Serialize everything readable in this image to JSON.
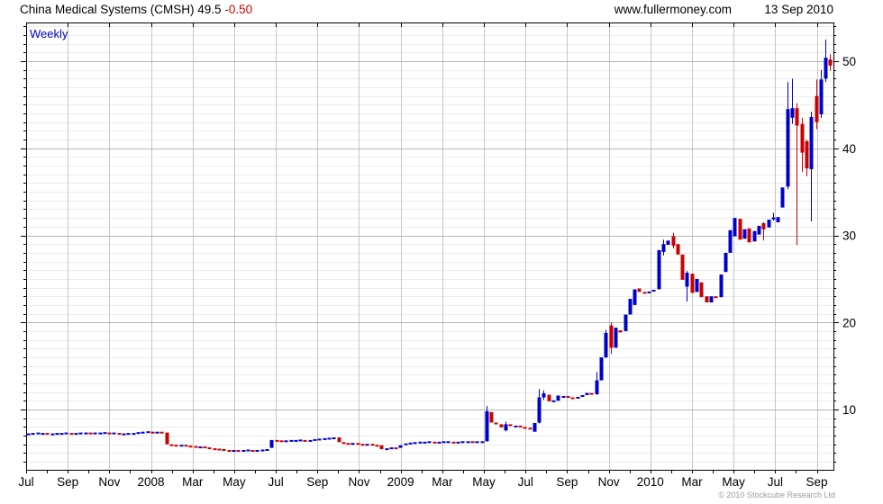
{
  "header": {
    "title": "China Medical Systems (CMSH) 49.5",
    "change": "-0.50",
    "site": "www.fullermoney.com",
    "date": "13 Sep 2010"
  },
  "footer": {
    "copyright": "© 2010 Stockcube Research Ltd"
  },
  "chart_data": {
    "type": "candlestick",
    "period_label": "Weekly",
    "title": "China Medical Systems (CMSH) weekly price",
    "colors": {
      "up": "#0000cc",
      "down": "#cc0000",
      "grid_minor": "#ececec",
      "grid_major": "#b5b5b5",
      "grid_vertical": "#c6c6c6",
      "frame": "#000000",
      "period_label": "#0000cc",
      "change_negative": "#cc0000",
      "copyright": "#9a9a9a"
    },
    "y_axis": {
      "ticks": [
        50,
        40,
        30,
        20,
        10
      ],
      "minor_step": 1,
      "minor_min": 4,
      "minor_max": 54,
      "range_top": 54.4,
      "range_bottom": 3.0,
      "scale": "linear",
      "side": "right"
    },
    "x_axis": {
      "months_visible": 38.8,
      "labels": [
        {
          "m": 0,
          "t": "Jul"
        },
        {
          "m": 2,
          "t": "Sep"
        },
        {
          "m": 4,
          "t": "Nov"
        },
        {
          "m": 6,
          "t": "2008"
        },
        {
          "m": 8,
          "t": "Mar"
        },
        {
          "m": 10,
          "t": "May"
        },
        {
          "m": 12,
          "t": "Jul"
        },
        {
          "m": 14,
          "t": "Sep"
        },
        {
          "m": 16,
          "t": "Nov"
        },
        {
          "m": 18,
          "t": "2009"
        },
        {
          "m": 20,
          "t": "Mar"
        },
        {
          "m": 22,
          "t": "May"
        },
        {
          "m": 24,
          "t": "Jul"
        },
        {
          "m": 26,
          "t": "Sep"
        },
        {
          "m": 28,
          "t": "Nov"
        },
        {
          "m": 30,
          "t": "2010"
        },
        {
          "m": 32,
          "t": "Mar"
        },
        {
          "m": 34,
          "t": "May"
        },
        {
          "m": 36,
          "t": "Jul"
        },
        {
          "m": 38,
          "t": "Sep"
        }
      ]
    },
    "weeks": [
      [
        7.2,
        7.25
      ],
      [
        7.25,
        7.3
      ],
      [
        7.3,
        7.35
      ],
      [
        7.25,
        7.3
      ],
      [
        7.3,
        7.2
      ],
      [
        7.2,
        7.25
      ],
      [
        7.25,
        7.3
      ],
      [
        7.25,
        7.3
      ],
      [
        7.3,
        7.35
      ],
      [
        7.3,
        7.25
      ],
      [
        7.25,
        7.3
      ],
      [
        7.3,
        7.35
      ],
      [
        7.3,
        7.35
      ],
      [
        7.35,
        7.3
      ],
      [
        7.3,
        7.35
      ],
      [
        7.3,
        7.35
      ],
      [
        7.35,
        7.4
      ],
      [
        7.35,
        7.3
      ],
      [
        7.3,
        7.35
      ],
      [
        7.3,
        7.2
      ],
      [
        7.2,
        7.25
      ],
      [
        7.25,
        7.3
      ],
      [
        7.25,
        7.3
      ],
      [
        7.3,
        7.4
      ],
      [
        7.4,
        7.45
      ],
      [
        7.4,
        7.5
      ],
      [
        7.45,
        7.4
      ],
      [
        7.4,
        7.45
      ],
      [
        7.45,
        7.35
      ],
      [
        7.35,
        6.0
      ],
      [
        6.0,
        5.95
      ],
      [
        5.95,
        5.9
      ],
      [
        5.9,
        5.95
      ],
      [
        5.95,
        5.85
      ],
      [
        5.85,
        5.8
      ],
      [
        5.8,
        5.7
      ],
      [
        5.7,
        5.75
      ],
      [
        5.75,
        5.65
      ],
      [
        5.65,
        5.55
      ],
      [
        5.55,
        5.5
      ],
      [
        5.5,
        5.45
      ],
      [
        5.45,
        5.35
      ],
      [
        5.35,
        5.3
      ],
      [
        5.3,
        5.35
      ],
      [
        5.35,
        5.3
      ],
      [
        5.3,
        5.35
      ],
      [
        5.35,
        5.4
      ],
      [
        5.35,
        5.3
      ],
      [
        5.3,
        5.35
      ],
      [
        5.35,
        5.4
      ],
      [
        5.4,
        5.45
      ],
      [
        5.6,
        6.5
      ],
      [
        6.5,
        6.45
      ],
      [
        6.45,
        6.4
      ],
      [
        6.4,
        6.45
      ],
      [
        6.45,
        6.5
      ],
      [
        6.45,
        6.5
      ],
      [
        6.5,
        6.55
      ],
      [
        6.5,
        6.45
      ],
      [
        6.45,
        6.5
      ],
      [
        6.5,
        6.6
      ],
      [
        6.6,
        6.65
      ],
      [
        6.6,
        6.7
      ],
      [
        6.7,
        6.75
      ],
      [
        6.75,
        6.8
      ],
      [
        6.8,
        6.25
      ],
      [
        6.25,
        6.15
      ],
      [
        6.15,
        6.1
      ],
      [
        6.1,
        6.15
      ],
      [
        6.15,
        6.05
      ],
      [
        6.05,
        6.0
      ],
      [
        6.0,
        6.05
      ],
      [
        6.05,
        5.95
      ],
      [
        5.95,
        5.9
      ],
      [
        5.9,
        5.45
      ],
      [
        5.45,
        5.55
      ],
      [
        5.55,
        5.65
      ],
      [
        5.65,
        5.6
      ],
      [
        5.6,
        5.9
      ],
      [
        5.9,
        6.1
      ],
      [
        6.1,
        6.2
      ],
      [
        6.2,
        6.25
      ],
      [
        6.25,
        6.3
      ],
      [
        6.25,
        6.3
      ],
      [
        6.3,
        6.35
      ],
      [
        6.3,
        6.25
      ],
      [
        6.25,
        6.3
      ],
      [
        6.3,
        6.35
      ],
      [
        6.3,
        6.35
      ],
      [
        6.3,
        6.25
      ],
      [
        6.25,
        6.3
      ],
      [
        6.3,
        6.35
      ],
      [
        6.3,
        6.35
      ],
      [
        6.35,
        6.3
      ],
      [
        6.3,
        6.35
      ],
      [
        6.3,
        6.35
      ],
      [
        6.35,
        9.8,
        10.4,
        6.3
      ],
      [
        9.7,
        8.5
      ],
      [
        8.5,
        8.3
      ],
      [
        8.3,
        7.95
      ],
      [
        7.6,
        8.3,
        8.6,
        7.5
      ],
      [
        8.3,
        8.1
      ],
      [
        8.1,
        8.15
      ],
      [
        8.15,
        8.0
      ],
      [
        8.0,
        7.9
      ],
      [
        7.9,
        7.8
      ],
      [
        7.45,
        8.45
      ],
      [
        8.5,
        11.4,
        12.35,
        8.4
      ],
      [
        11.4,
        11.85,
        12.2,
        11.1
      ],
      [
        11.7,
        10.95
      ],
      [
        10.95,
        11.05
      ],
      [
        11.0,
        11.6
      ],
      [
        11.5,
        11.55
      ],
      [
        11.55,
        11.4
      ],
      [
        11.4,
        11.3
      ],
      [
        11.3,
        11.45
      ],
      [
        11.45,
        11.65
      ],
      [
        11.65,
        11.9
      ],
      [
        11.9,
        11.8
      ],
      [
        11.75,
        13.35,
        14.3,
        11.7
      ],
      [
        13.35,
        16.0
      ],
      [
        16.0,
        18.8,
        19.15,
        15.9
      ],
      [
        19.65,
        17.1,
        20.0,
        16.4
      ],
      [
        17.1,
        19.4
      ],
      [
        19.1,
        18.85
      ],
      [
        19.0,
        20.9
      ],
      [
        20.9,
        22.7
      ],
      [
        22.0,
        23.8
      ],
      [
        23.9,
        23.5
      ],
      [
        23.5,
        23.4
      ],
      [
        23.4,
        23.55
      ],
      [
        23.55,
        23.75
      ],
      [
        23.8,
        28.3
      ],
      [
        28.1,
        29.0,
        29.5,
        27.7
      ],
      [
        28.9,
        29.4
      ],
      [
        29.9,
        28.8,
        30.3,
        28.5
      ],
      [
        29.0,
        27.8
      ],
      [
        27.8,
        24.9
      ],
      [
        24.1,
        25.7,
        25.9,
        22.4
      ],
      [
        25.6,
        23.4
      ],
      [
        23.5,
        25.0
      ],
      [
        24.6,
        22.9
      ],
      [
        23.0,
        22.3
      ],
      [
        22.3,
        23.0
      ],
      [
        23.0,
        22.85
      ],
      [
        22.9,
        25.5
      ],
      [
        25.8,
        28.0
      ],
      [
        28.0,
        30.6
      ],
      [
        29.9,
        32.0
      ],
      [
        31.9,
        29.5
      ],
      [
        29.6,
        30.7
      ],
      [
        30.8,
        29.2
      ],
      [
        29.3,
        30.5
      ],
      [
        30.1,
        31.1
      ],
      [
        31.4,
        30.7,
        31.5,
        29.4
      ],
      [
        30.9,
        31.8
      ],
      [
        31.9,
        32.05,
        32.6,
        31.7
      ],
      [
        31.5,
        32.1
      ],
      [
        33.2,
        35.5
      ],
      [
        35.6,
        44.5,
        47.6,
        35.3
      ],
      [
        43.5,
        44.6,
        48.0,
        42.8
      ],
      [
        44.6,
        42.6,
        45.2,
        28.9
      ],
      [
        42.8,
        39.5,
        43.5,
        37.3
      ],
      [
        40.8,
        37.7,
        41.0,
        36.8
      ],
      [
        37.6,
        43.6,
        44.2,
        31.6
      ],
      [
        46.0,
        43.0,
        47.9,
        42.2
      ],
      [
        43.9,
        47.9,
        49.0,
        43.5
      ],
      [
        48.0,
        50.4,
        52.5,
        47.6
      ],
      [
        50.2,
        49.5,
        50.8,
        48.9
      ]
    ]
  }
}
